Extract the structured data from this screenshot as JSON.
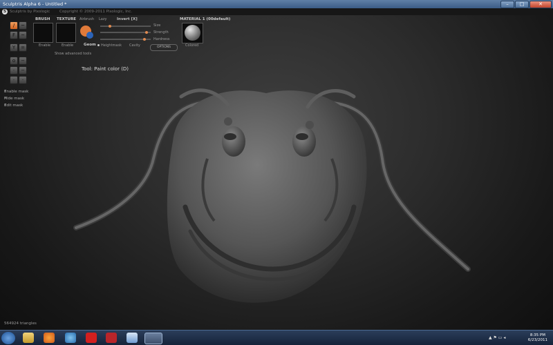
{
  "window": {
    "title": "Sculptris Alpha 6 - Untitled *",
    "buttons": [
      "–",
      "□",
      "✕"
    ]
  },
  "app": {
    "logo": "S",
    "name": "Sculptris by Pixologic",
    "copyright": "Copyright © 2009-2011 Pixologic, Inc."
  },
  "panel": {
    "brush_label": "BRUSH",
    "texture_label": "TEXTURE",
    "brush_enable": "Enable",
    "texture_enable": "Enable",
    "airbrush": "Airbrush",
    "lazy": "Lazy",
    "invert": "Invert [X]",
    "size": "Size",
    "strength": "Strength",
    "hardness": "Hardness",
    "geom": "Geom",
    "heightmask": "Heightmask",
    "cavity": "Cavity",
    "options": "OPTIONS",
    "material_label": "MATERIAL 1 (00default)",
    "colored": "Colored",
    "show_advanced": "Show advanced tools"
  },
  "left_masks": [
    "Enable mask",
    "Hide mask",
    "Edit mask"
  ],
  "tool_status": "Tool: Paint color (D)",
  "triangles": "564924 triangles",
  "taskbar": {
    "time": "8:35 PM",
    "date": "6/23/2011"
  },
  "colors": {
    "accent": "#e07a3a",
    "viewport": "#2c2c2c"
  }
}
